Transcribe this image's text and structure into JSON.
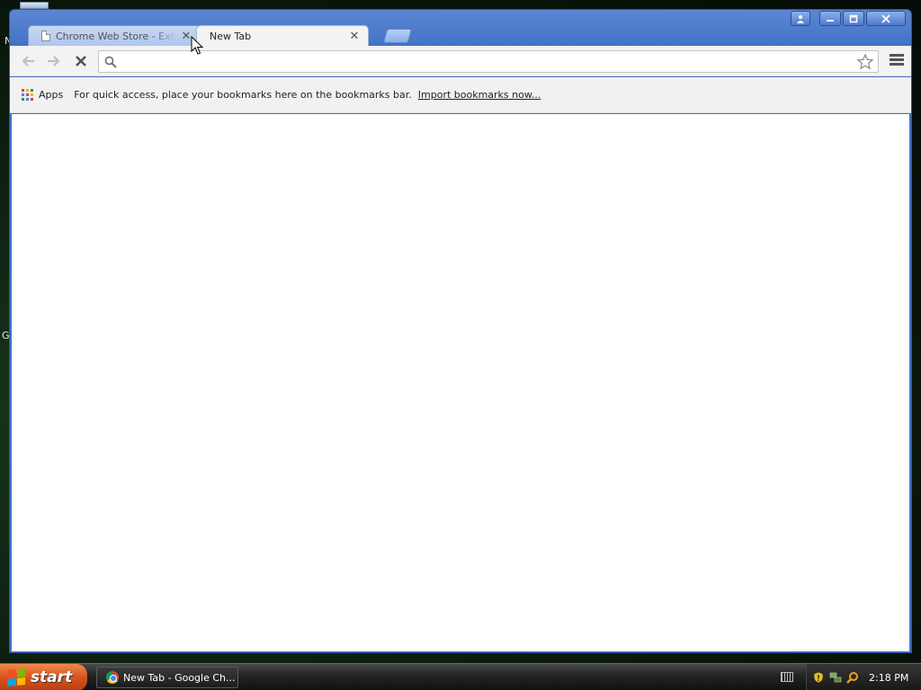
{
  "desktop": {
    "edge_letter_1": "N",
    "edge_letter_2": "G"
  },
  "browser": {
    "tabs": [
      {
        "title": "Chrome Web Store - Extensions",
        "active": false
      },
      {
        "title": "New Tab",
        "active": true
      }
    ],
    "omnibox": {
      "value": "",
      "placeholder": ""
    },
    "bookmarks_bar": {
      "apps_label": "Apps",
      "message": "For quick access, place your bookmarks here on the bookmarks bar.",
      "import_link": "Import bookmarks now..."
    },
    "loading": true
  },
  "taskbar": {
    "start_label": "start",
    "task_button_label": "New Tab - Google Ch...",
    "clock": "2:18 PM"
  },
  "colors": {
    "titlebar": "#4a77c9",
    "start_button": "#d9531f",
    "apps_grid": [
      "#db4437",
      "#f4b400",
      "#0f9d58",
      "#4285f4",
      "#db4437",
      "#f4b400",
      "#0f9d58",
      "#4285f4",
      "#db4437"
    ]
  }
}
